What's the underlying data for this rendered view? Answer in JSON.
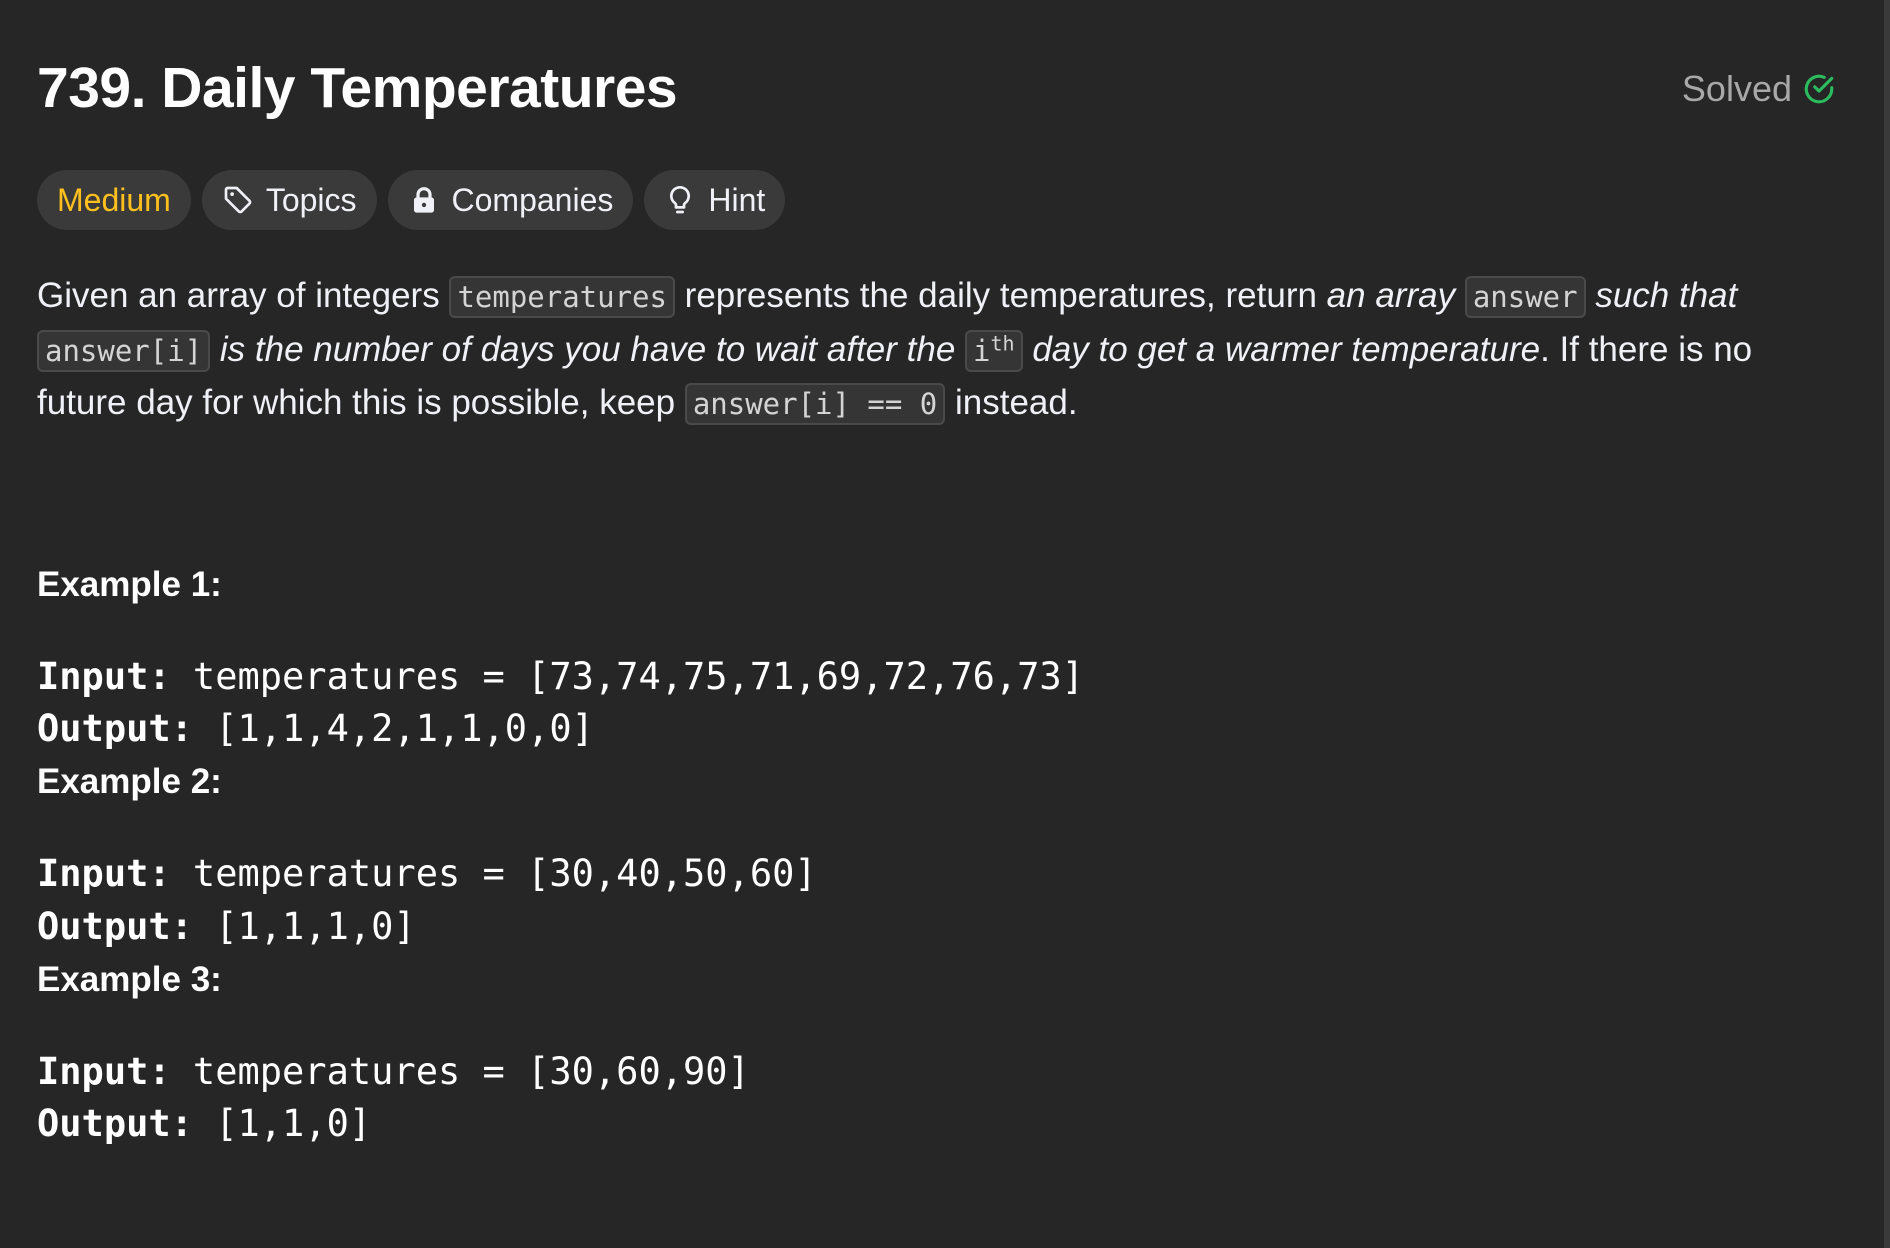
{
  "problem": {
    "title": "739. Daily Temperatures",
    "status": "Solved",
    "status_color": "#2cbb5d"
  },
  "tags": {
    "difficulty": "Medium",
    "difficulty_color": "#ffc01e",
    "topics": "Topics",
    "companies": "Companies",
    "hint": "Hint"
  },
  "description": {
    "t1": "Given an array of integers ",
    "c1": "temperatures",
    "t2": " represents the daily temperatures, return ",
    "i1": "an array",
    "t3": " ",
    "c2": "answer",
    "t4": " ",
    "i2": "such that",
    "t5": " ",
    "c3": "answer[i]",
    "t6": " ",
    "i3": "is the number of days you have to wait after the",
    "t7": " ",
    "c4_base": "i",
    "c4_sup": "th",
    "t8": " ",
    "i4": "day to get a warmer temperature",
    "t9": ". If there is no future day for which this is possible, keep ",
    "c5": "answer[i] == 0",
    "t10": " instead."
  },
  "examples": [
    {
      "title": "Example 1:",
      "input_label": "Input:",
      "input": " temperatures = [73,74,75,71,69,72,76,73]",
      "output_label": "Output:",
      "output": " [1,1,4,2,1,1,0,0]"
    },
    {
      "title": "Example 2:",
      "input_label": "Input:",
      "input": " temperatures = [30,40,50,60]",
      "output_label": "Output:",
      "output": " [1,1,1,0]"
    },
    {
      "title": "Example 3:",
      "input_label": "Input:",
      "input": " temperatures = [30,60,90]",
      "output_label": "Output:",
      "output": " [1,1,0]"
    }
  ],
  "icons": {
    "solved": "check-circle-icon",
    "topics": "tag-icon",
    "companies": "lock-icon",
    "hint": "lightbulb-icon"
  }
}
